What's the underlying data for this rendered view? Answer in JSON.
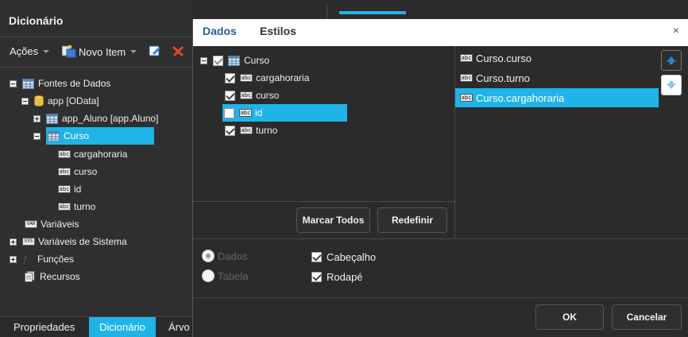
{
  "left_panel": {
    "title": "Dicionário",
    "toolbar": {
      "actions": "Ações",
      "new_item": "Novo Item"
    },
    "tree": {
      "data_sources": "Fontes de Dados",
      "app": "app [OData]",
      "app_aluno": "app_Aluno [app.Aluno]",
      "curso": "Curso",
      "fields": [
        "cargahoraria",
        "curso",
        "id",
        "turno"
      ],
      "variables": "Variáveis",
      "system_variables": "Variáveis de Sistema",
      "functions": "Funções",
      "resources": "Recursos"
    },
    "bottom_tabs": [
      "Propriedades",
      "Dicionário",
      "Árvo"
    ]
  },
  "dialog": {
    "tabs": [
      "Dados",
      "Estilos"
    ],
    "close": "×",
    "columns": {
      "parent": "Curso",
      "items": [
        {
          "label": "cargahoraria",
          "checked": true
        },
        {
          "label": "curso",
          "checked": true
        },
        {
          "label": "id",
          "checked": false
        },
        {
          "label": "turno",
          "checked": true
        }
      ]
    },
    "buttons": {
      "mark_all": "Marcar Todos",
      "reset": "Redefinir",
      "ok": "OK",
      "cancel": "Cancelar"
    },
    "order": [
      "Curso.curso",
      "Curso.turno",
      "Curso.cargahoraria"
    ],
    "options": {
      "radio_dados": "Dados",
      "radio_tabela": "Tabela",
      "header": "Cabeçalho",
      "footer": "Rodapé"
    }
  },
  "colors": {
    "accent": "#1fb4e8",
    "dialog_header": "#ffffff",
    "active_tab_text": "#2a5d9f"
  }
}
